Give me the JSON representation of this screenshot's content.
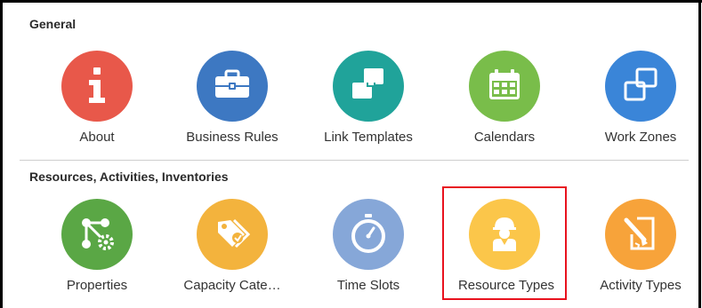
{
  "sections": [
    {
      "title": "General",
      "tiles": [
        {
          "label": "About",
          "icon": "info-icon",
          "color": "#e8584a"
        },
        {
          "label": "Business Rules",
          "icon": "briefcase-icon",
          "color": "#3d78c2"
        },
        {
          "label": "Link Templates",
          "icon": "link-template-icon",
          "color": "#20a39a"
        },
        {
          "label": "Calendars",
          "icon": "calendar-icon",
          "color": "#79bd4a"
        },
        {
          "label": "Work Zones",
          "icon": "work-zones-icon",
          "color": "#3a85d8"
        }
      ]
    },
    {
      "title": "Resources, Activities, Inventories",
      "tiles": [
        {
          "label": "Properties",
          "icon": "properties-icon",
          "color": "#5aa745"
        },
        {
          "label": "Capacity Cate…",
          "icon": "tags-icon",
          "color": "#f3b33d"
        },
        {
          "label": "Time Slots",
          "icon": "stopwatch-icon",
          "color": "#86a7d8"
        },
        {
          "label": "Resource Types",
          "icon": "worker-icon",
          "color": "#fbc64a",
          "selected": true
        },
        {
          "label": "Activity Types",
          "icon": "activity-types-icon",
          "color": "#f7a33a"
        }
      ]
    }
  ],
  "colors": {
    "selection_border": "#e8121e",
    "divider": "#cfcfcf",
    "text": "#333333"
  }
}
